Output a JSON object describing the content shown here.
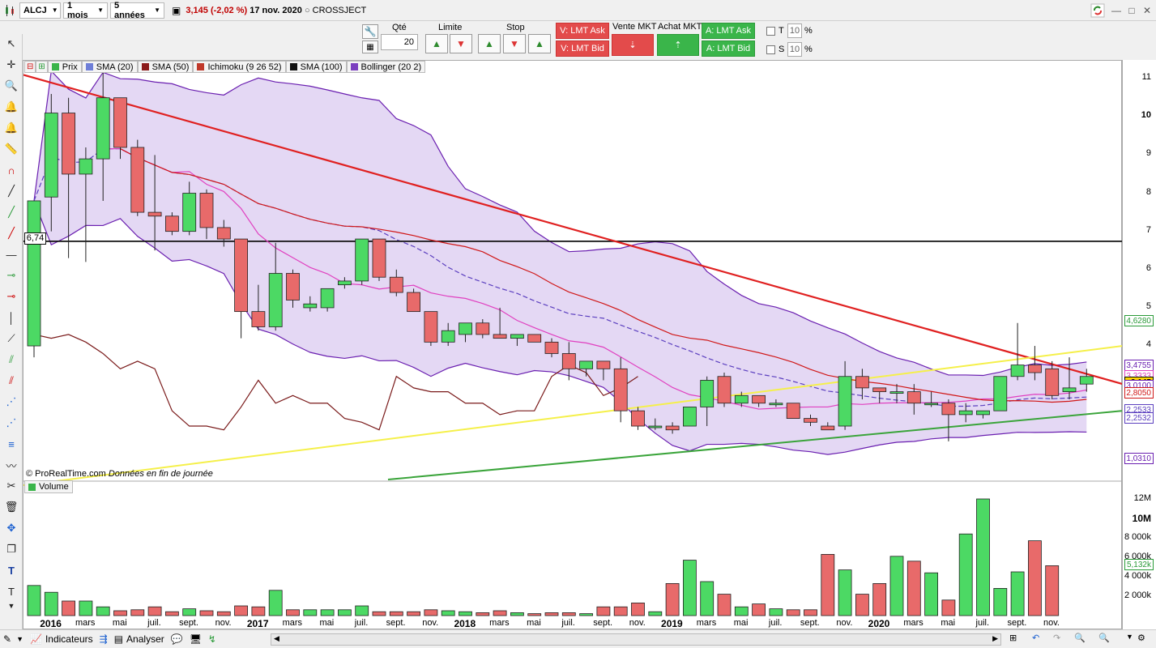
{
  "toolbar": {
    "symbol": "ALCJ",
    "period": "1 mois",
    "range": "5 années",
    "price": "3,145",
    "change": "(-2,02 %)",
    "date": "17 nov. 2020",
    "name": "CROSSJECT"
  },
  "order": {
    "qty_label": "Qté",
    "qty_value": "20",
    "limite_label": "Limite",
    "stop_label": "Stop",
    "sell_ask": "V: LMT Ask",
    "sell_bid": "V: LMT Bid",
    "vente_mkt": "Vente MKT",
    "achat_mkt": "Achat MKT",
    "buy_ask": "A: LMT Ask",
    "buy_bid": "A: LMT Bid",
    "t_label": "T",
    "s_label": "S",
    "t_value": "10",
    "s_value": "10",
    "pct": "%"
  },
  "legend": [
    {
      "label": "Prix",
      "color": "#3ab54a"
    },
    {
      "label": "SMA (20)",
      "color": "#6f7fd8"
    },
    {
      "label": "SMA (50)",
      "color": "#8b1a1a"
    },
    {
      "label": "Ichimoku (9 26 52)",
      "color": "#c0392b"
    },
    {
      "label": "SMA (100)",
      "color": "#111111"
    },
    {
      "label": "Bollinger (20 2)",
      "color": "#7b3fbf"
    }
  ],
  "copyright": "© ProRealTime.com",
  "copyright_note": "Données en fin de journée",
  "volume_label": "Volume",
  "price_axis": [
    "11",
    "10",
    "9",
    "8",
    "7",
    "6",
    "5",
    "4"
  ],
  "price_tags": {
    "level": "6,74",
    "t1": "4,6280",
    "t2": "3,4755",
    "t3": "3,3333",
    "t4": "3,145",
    "t5": "3,0100",
    "t6": "2,8050",
    "t7": "2,2533",
    "t8": "2,2532",
    "t9": "1,0310"
  },
  "volume_axis": [
    "12M",
    "10M",
    "8 000k",
    "6 000k",
    "4 000k",
    "2 000k"
  ],
  "volume_tag": "5,132k",
  "x_labels": [
    {
      "t": "2016",
      "b": true
    },
    {
      "t": "mars",
      "b": false
    },
    {
      "t": "mai",
      "b": false
    },
    {
      "t": "juil.",
      "b": false
    },
    {
      "t": "sept.",
      "b": false
    },
    {
      "t": "nov.",
      "b": false
    },
    {
      "t": "2017",
      "b": true
    },
    {
      "t": "mars",
      "b": false
    },
    {
      "t": "mai",
      "b": false
    },
    {
      "t": "juil.",
      "b": false
    },
    {
      "t": "sept.",
      "b": false
    },
    {
      "t": "nov.",
      "b": false
    },
    {
      "t": "2018",
      "b": true
    },
    {
      "t": "mars",
      "b": false
    },
    {
      "t": "mai",
      "b": false
    },
    {
      "t": "juil.",
      "b": false
    },
    {
      "t": "sept.",
      "b": false
    },
    {
      "t": "nov.",
      "b": false
    },
    {
      "t": "2019",
      "b": true
    },
    {
      "t": "mars",
      "b": false
    },
    {
      "t": "mai",
      "b": false
    },
    {
      "t": "juil.",
      "b": false
    },
    {
      "t": "sept.",
      "b": false
    },
    {
      "t": "nov.",
      "b": false
    },
    {
      "t": "2020",
      "b": true
    },
    {
      "t": "mars",
      "b": false
    },
    {
      "t": "mai",
      "b": false
    },
    {
      "t": "juil.",
      "b": false
    },
    {
      "t": "sept.",
      "b": false
    },
    {
      "t": "nov.",
      "b": false
    }
  ],
  "bottom": {
    "indicators": "Indicateurs",
    "analyser": "Analyser"
  },
  "chart_data": {
    "type": "candlestick",
    "months": [
      "2015-12",
      "2016-01",
      "2016-02",
      "2016-03",
      "2016-04",
      "2016-05",
      "2016-06",
      "2016-07",
      "2016-08",
      "2016-09",
      "2016-10",
      "2016-11",
      "2016-12",
      "2017-01",
      "2017-02",
      "2017-03",
      "2017-04",
      "2017-05",
      "2017-06",
      "2017-07",
      "2017-08",
      "2017-09",
      "2017-10",
      "2017-11",
      "2017-12",
      "2018-01",
      "2018-02",
      "2018-03",
      "2018-04",
      "2018-05",
      "2018-06",
      "2018-07",
      "2018-08",
      "2018-09",
      "2018-10",
      "2018-11",
      "2018-12",
      "2019-01",
      "2019-02",
      "2019-03",
      "2019-04",
      "2019-05",
      "2019-06",
      "2019-07",
      "2019-08",
      "2019-09",
      "2019-10",
      "2019-11",
      "2019-12",
      "2020-01",
      "2020-02",
      "2020-03",
      "2020-04",
      "2020-05",
      "2020-06",
      "2020-07",
      "2020-08",
      "2020-09",
      "2020-10",
      "2020-11"
    ],
    "ohlc": [
      [
        4.0,
        7.8,
        3.7,
        7.8
      ],
      [
        7.9,
        10.6,
        7.0,
        10.1
      ],
      [
        10.1,
        10.5,
        6.3,
        8.5
      ],
      [
        8.5,
        9.2,
        6.2,
        8.9
      ],
      [
        8.9,
        11.2,
        7.8,
        10.5
      ],
      [
        10.5,
        10.5,
        8.9,
        9.2
      ],
      [
        9.2,
        9.4,
        7.4,
        7.5
      ],
      [
        7.5,
        9.0,
        6.5,
        7.4
      ],
      [
        7.4,
        7.5,
        6.9,
        7.0
      ],
      [
        7.0,
        8.3,
        6.9,
        8.0
      ],
      [
        8.0,
        8.1,
        6.8,
        7.1
      ],
      [
        7.1,
        7.3,
        6.6,
        6.8
      ],
      [
        6.8,
        6.8,
        4.2,
        4.9
      ],
      [
        4.9,
        5.6,
        4.4,
        4.5
      ],
      [
        4.5,
        6.7,
        4.4,
        5.9
      ],
      [
        5.9,
        6.0,
        5.0,
        5.2
      ],
      [
        5.0,
        5.3,
        4.9,
        5.1
      ],
      [
        5.0,
        5.5,
        4.9,
        5.5
      ],
      [
        5.6,
        5.8,
        5.5,
        5.7
      ],
      [
        5.7,
        6.8,
        5.6,
        6.8
      ],
      [
        6.8,
        6.8,
        5.7,
        5.8
      ],
      [
        5.8,
        6.0,
        5.3,
        5.4
      ],
      [
        5.4,
        5.5,
        4.9,
        4.9
      ],
      [
        4.9,
        4.9,
        4.0,
        4.1
      ],
      [
        4.1,
        4.6,
        4.0,
        4.4
      ],
      [
        4.3,
        4.6,
        4.1,
        4.6
      ],
      [
        4.6,
        4.7,
        4.2,
        4.3
      ],
      [
        4.3,
        5.0,
        4.2,
        4.2
      ],
      [
        4.2,
        4.3,
        4.0,
        4.3
      ],
      [
        4.3,
        4.3,
        4.1,
        4.1
      ],
      [
        4.1,
        4.2,
        3.7,
        3.8
      ],
      [
        3.8,
        4.1,
        3.1,
        3.4
      ],
      [
        3.4,
        3.6,
        3.2,
        3.6
      ],
      [
        3.6,
        3.6,
        3.1,
        3.4
      ],
      [
        3.4,
        3.7,
        2.0,
        2.3
      ],
      [
        2.3,
        2.4,
        1.8,
        1.9
      ],
      [
        1.9,
        2.1,
        1.8,
        1.9
      ],
      [
        1.9,
        2.0,
        1.7,
        1.8
      ],
      [
        1.9,
        2.4,
        1.9,
        2.4
      ],
      [
        2.4,
        3.2,
        1.9,
        3.1
      ],
      [
        3.2,
        3.3,
        2.4,
        2.5
      ],
      [
        2.5,
        2.8,
        2.4,
        2.7
      ],
      [
        2.7,
        2.7,
        2.4,
        2.5
      ],
      [
        2.5,
        2.6,
        2.4,
        2.5
      ],
      [
        2.5,
        2.5,
        2.1,
        2.1
      ],
      [
        2.1,
        2.2,
        1.9,
        2.0
      ],
      [
        1.9,
        2.0,
        1.8,
        1.8
      ],
      [
        1.9,
        3.6,
        1.8,
        3.2
      ],
      [
        3.2,
        3.4,
        2.6,
        2.9
      ],
      [
        2.9,
        2.9,
        2.5,
        2.8
      ],
      [
        2.8,
        3.0,
        2.5,
        2.8
      ],
      [
        2.8,
        3.0,
        2.2,
        2.5
      ],
      [
        2.5,
        2.8,
        2.4,
        2.5
      ],
      [
        2.5,
        2.6,
        1.5,
        2.2
      ],
      [
        2.2,
        2.5,
        2.0,
        2.3
      ],
      [
        2.2,
        2.3,
        2.1,
        2.3
      ],
      [
        2.3,
        3.2,
        2.3,
        3.2
      ],
      [
        3.2,
        4.6,
        3.1,
        3.5
      ],
      [
        3.5,
        4.0,
        3.1,
        3.3
      ],
      [
        3.4,
        3.6,
        2.6,
        2.7
      ],
      [
        2.8,
        3.7,
        2.6,
        2.9
      ],
      [
        3.0,
        3.4,
        2.8,
        3.2
      ]
    ],
    "volumes_k": [
      3100,
      2400,
      1500,
      1500,
      900,
      500,
      600,
      900,
      400,
      700,
      500,
      400,
      1000,
      900,
      2600,
      600,
      600,
      600,
      600,
      1000,
      400,
      400,
      400,
      600,
      500,
      400,
      300,
      500,
      300,
      200,
      300,
      300,
      200,
      900,
      900,
      1300,
      400,
      3300,
      5700,
      3500,
      2200,
      900,
      1200,
      700,
      600,
      600,
      6300,
      4700,
      2200,
      3300,
      6100,
      5600,
      4400,
      1600,
      8400,
      12000,
      2800,
      4500,
      7700,
      5132
    ],
    "price_ylim": [
      0.5,
      11.3
    ],
    "volume_ylim": [
      0,
      12500
    ]
  }
}
